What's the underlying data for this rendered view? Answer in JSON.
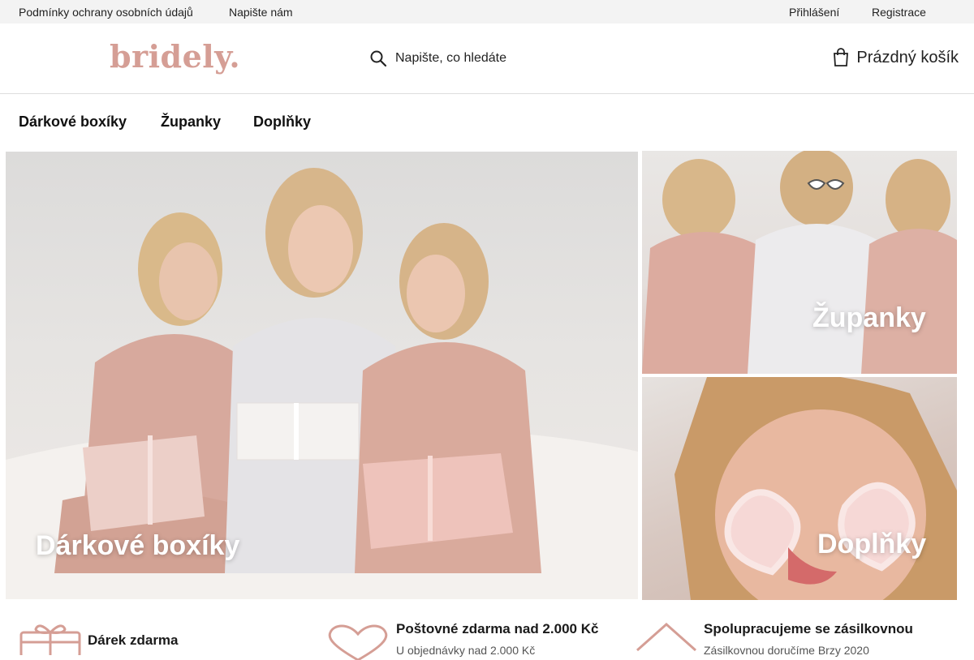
{
  "topbar": {
    "links_left": [
      "Podmínky ochrany osobních údajů",
      "Napište nám"
    ],
    "login": "Přihlášení",
    "register": "Registrace"
  },
  "header": {
    "logo": "bridely.",
    "search_placeholder": "Napište, co hledáte",
    "cart_label": "Prázdný košík"
  },
  "nav": {
    "items": [
      "Dárkové boxíky",
      "Županky",
      "Doplňky"
    ]
  },
  "tiles": {
    "main": "Dárkové boxíky",
    "top": "Županky",
    "bottom": "Doplňky"
  },
  "features": [
    {
      "title": "Dárek zdarma",
      "icon": "gift-icon"
    },
    {
      "title": "Poštovné zdarma nad 2.000 Kč",
      "subtitle": "U objednávky nad 2.000 Kč",
      "icon": "heart-icon"
    },
    {
      "title": "Spolupracujeme se zásilkovnou",
      "subtitle": "Zásilkovnou doručíme Brzy 2020",
      "icon": "house-icon"
    }
  ],
  "colors": {
    "brand": "#d59e95",
    "topbar_bg": "#f3f3f3"
  }
}
